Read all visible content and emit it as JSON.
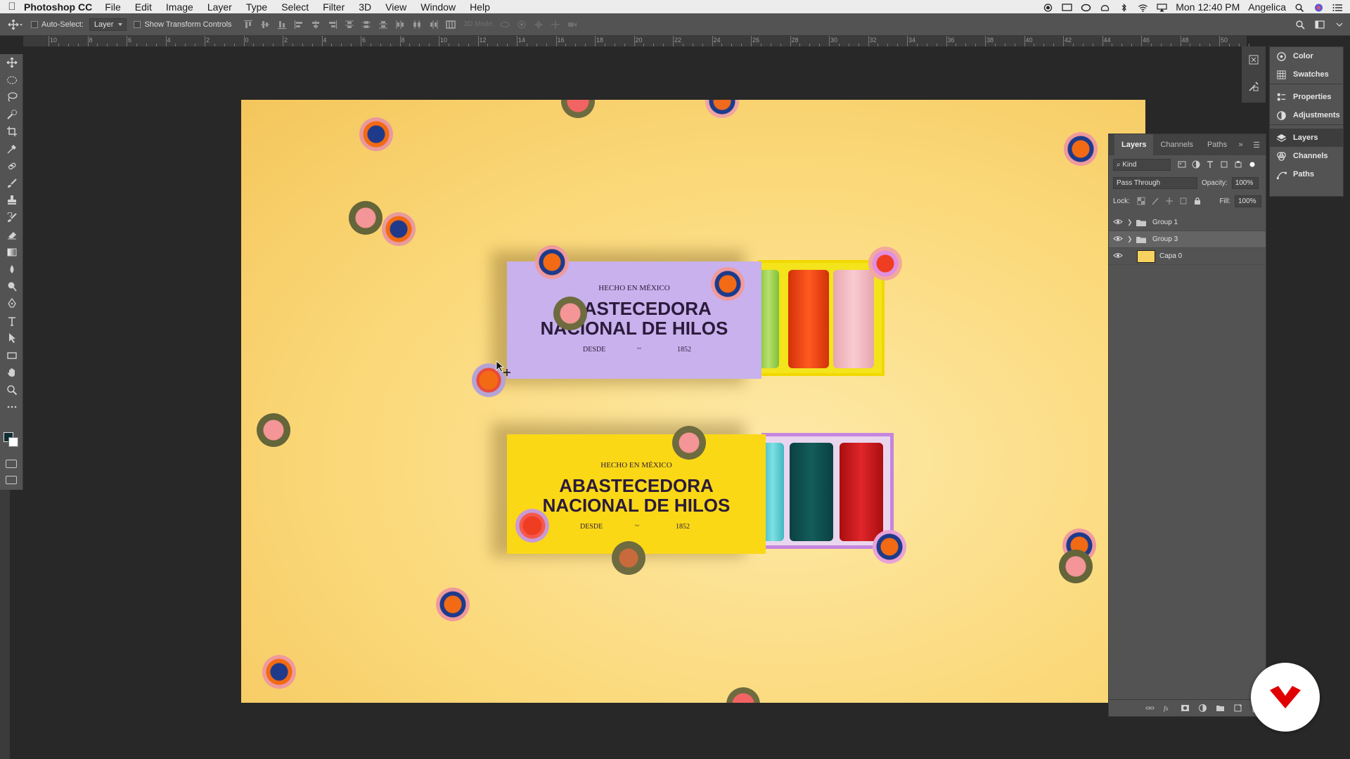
{
  "menubar": {
    "app_name": "Photoshop CC",
    "items": [
      "File",
      "Edit",
      "Image",
      "Layer",
      "Type",
      "Select",
      "Filter",
      "3D",
      "View",
      "Window",
      "Help"
    ],
    "clock": "Mon 12:40 PM",
    "user": "Angelica"
  },
  "options": {
    "auto_select_label": "Auto-Select:",
    "auto_select_value": "Layer",
    "transform_label": "Show Transform Controls",
    "mode_3d_label": "3D Mode:"
  },
  "ruler": {
    "top_labels": [
      "10",
      "8",
      "6",
      "4",
      "2",
      "0",
      "2",
      "4",
      "6",
      "8",
      "10",
      "12",
      "14",
      "16",
      "18",
      "20",
      "22",
      "24",
      "26",
      "28",
      "30",
      "32",
      "34",
      "36",
      "38",
      "40",
      "42",
      "44",
      "46",
      "48",
      "50"
    ]
  },
  "canvas": {
    "box1": {
      "line1": "HECHO EN MÉXICO",
      "line2": "ABASTECEDORA",
      "line3": "NACIONAL DE HILOS",
      "left": "DESDE",
      "mid": "~",
      "right": "1852"
    },
    "box2": {
      "line1": "HECHO EN MÉXICO",
      "line2": "ABASTECEDORA",
      "line3": "NACIONAL DE HILOS",
      "left": "DESDE",
      "mid": "~",
      "right": "1852"
    }
  },
  "dock": {
    "items": [
      "Color",
      "Swatches",
      "Properties",
      "Adjustments",
      "Layers",
      "Channels",
      "Paths"
    ]
  },
  "layers_panel": {
    "tabs": [
      "Layers",
      "Channels",
      "Paths"
    ],
    "filter_kind": "Kind",
    "blend_mode": "Pass Through",
    "opacity_label": "Opacity:",
    "opacity_value": "100%",
    "lock_label": "Lock:",
    "fill_label": "Fill:",
    "fill_value": "100%",
    "layers": [
      {
        "name": "Group 1",
        "type": "group",
        "selected": false
      },
      {
        "name": "Group 3",
        "type": "group",
        "selected": true
      },
      {
        "name": "Capa 0",
        "type": "image",
        "selected": false
      }
    ]
  },
  "colors": {
    "foreground": "#0e2d34",
    "background": "#ffffff",
    "logo_red": "#e10000"
  }
}
